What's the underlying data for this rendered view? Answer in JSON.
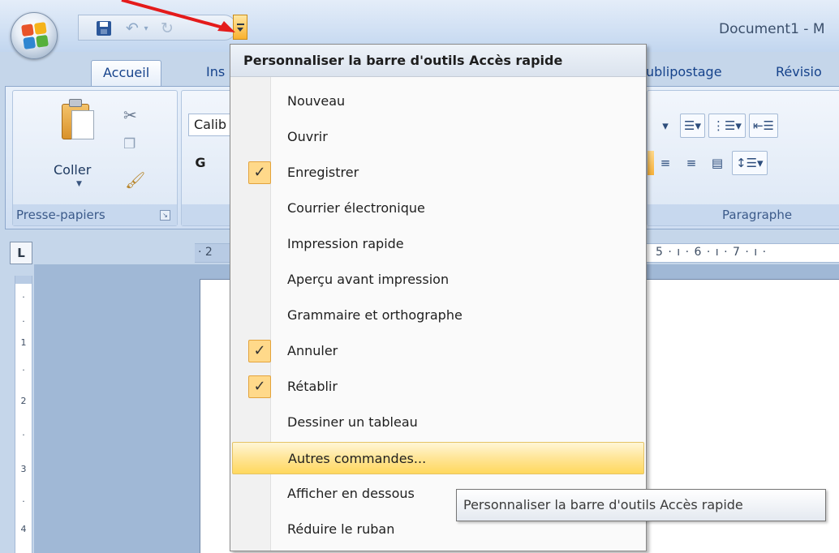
{
  "titlebar": {
    "document_title": "Document1 - M"
  },
  "quick_access": {
    "save_icon": "save-icon",
    "undo_icon": "undo-icon",
    "redo_icon": "redo-icon",
    "customize_icon": "customize-qat-icon"
  },
  "tabs": [
    {
      "label": "Accueil",
      "active": true
    },
    {
      "label": "Ins"
    },
    {
      "label": "ublipostage"
    },
    {
      "label": "Révisio"
    }
  ],
  "ribbon": {
    "clipboard": {
      "paste_label": "Coller",
      "group_label": "Presse-papiers"
    },
    "font": {
      "font_name": "Calib",
      "bold_label": "G"
    },
    "paragraph": {
      "group_label": "Paragraphe"
    }
  },
  "ruler": {
    "corner_label": "L",
    "h_left": "· 2",
    "h_right": "5 · ı · 6 · ı · 7 · ı ·",
    "v_ticks": [
      "·",
      "·",
      "1",
      "·",
      "2",
      "·",
      "3",
      "·",
      "4"
    ]
  },
  "menu": {
    "header": "Personnaliser la barre d'outils Accès rapide",
    "items": [
      {
        "label": "Nouveau",
        "checked": false
      },
      {
        "label": "Ouvrir",
        "checked": false
      },
      {
        "label": "Enregistrer",
        "checked": true
      },
      {
        "label": "Courrier électronique",
        "checked": false
      },
      {
        "label": "Impression rapide",
        "checked": false
      },
      {
        "label": "Aperçu avant impression",
        "checked": false
      },
      {
        "label": "Grammaire et orthographe",
        "checked": false
      },
      {
        "label": "Annuler",
        "checked": true
      },
      {
        "label": "Rétablir",
        "checked": true
      },
      {
        "label": "Dessiner un tableau",
        "checked": false
      },
      {
        "label": "Autres commandes...",
        "checked": false,
        "highlighted": true
      },
      {
        "label": "Afficher en dessous",
        "checked": false
      },
      {
        "label": "Réduire le ruban",
        "checked": false
      }
    ],
    "check_glyph": "✓"
  },
  "tooltip": {
    "text": "Personnaliser la barre d'outils Accès rapide"
  },
  "colors": {
    "accent": "#ffd85d",
    "annotation_arrow": "#e41b1b"
  }
}
